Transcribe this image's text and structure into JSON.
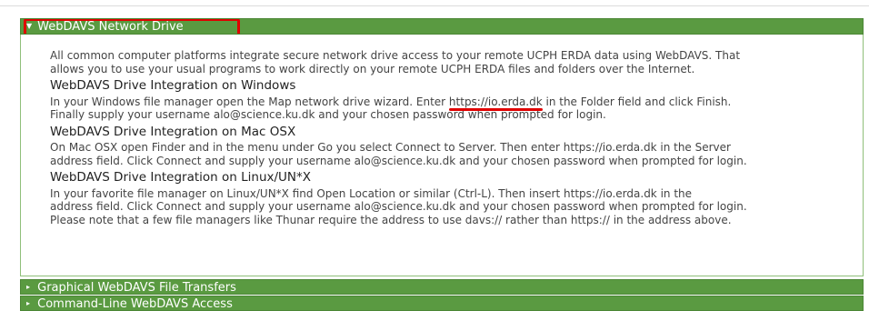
{
  "sections": {
    "active": {
      "title": "WebDAVS Network Drive",
      "intro_1": "All common computer platforms integrate secure network drive access to your remote UCPH ERDA data using WebDAVS. That",
      "intro_2": "allows you to use your usual programs to work directly on your remote UCPH ERDA files and folders over the Internet.",
      "windows": {
        "heading": "WebDAVS Drive Integration on Windows",
        "line_1_pre": "In your Windows file manager open the Map network drive wizard. Enter ",
        "url": "https://io.erda.dk",
        "line_1_post": " in the Folder field and click Finish.",
        "line_2": "Finally supply your username alo@science.ku.dk and your chosen password when prompted for login."
      },
      "mac": {
        "heading": "WebDAVS Drive Integration on Mac OSX",
        "line_1": "On Mac OSX open Finder and in the menu under Go you select Connect to Server. Then enter https://io.erda.dk in the Server",
        "line_2": "address field. Click Connect and supply your username alo@science.ku.dk and your chosen password when prompted for login."
      },
      "linux": {
        "heading": "WebDAVS Drive Integration on Linux/UN*X",
        "line_1": "In your favorite file manager on Linux/UN*X find Open Location or similar (Ctrl-L). Then insert https://io.erda.dk in the",
        "line_2": "address field. Click Connect and supply your username alo@science.ku.dk and your chosen password when prompted for login.",
        "line_3": "Please note that a few file managers like Thunar require the address to use davs:// rather than https:// in the address above."
      }
    },
    "collapsed": [
      {
        "title": "Graphical WebDAVS File Transfers"
      },
      {
        "title": "Command-Line WebDAVS Access"
      }
    ]
  },
  "icons": {
    "expanded": "triangle-down-icon",
    "collapsed": "triangle-right-icon"
  },
  "colors": {
    "header_green": "#5a9a41",
    "highlight_red": "#e00000"
  }
}
